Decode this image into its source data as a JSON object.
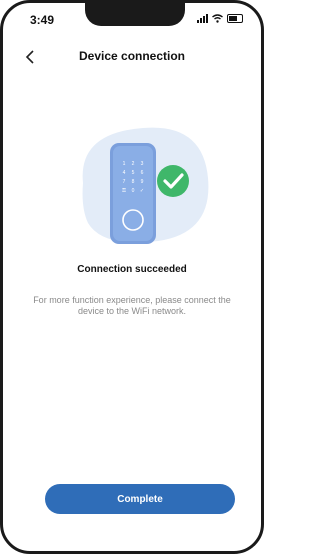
{
  "status_bar": {
    "time": "3:49"
  },
  "header": {
    "title": "Device connection",
    "back_icon": "chevron-left-icon"
  },
  "illustration": {
    "keypad_keys": [
      "1",
      "2",
      "3",
      "4",
      "5",
      "6",
      "7",
      "8",
      "9",
      "⚿",
      "0",
      "✓"
    ],
    "check_icon": "check-icon"
  },
  "main": {
    "success_message": "Connection succeeded",
    "hint": "For more function experience, please connect the device to the WiFi network."
  },
  "footer": {
    "complete_label": "Complete"
  },
  "colors": {
    "accent": "#2f6db8",
    "success": "#3fb76a",
    "lock_body": "#7b9fdc"
  }
}
